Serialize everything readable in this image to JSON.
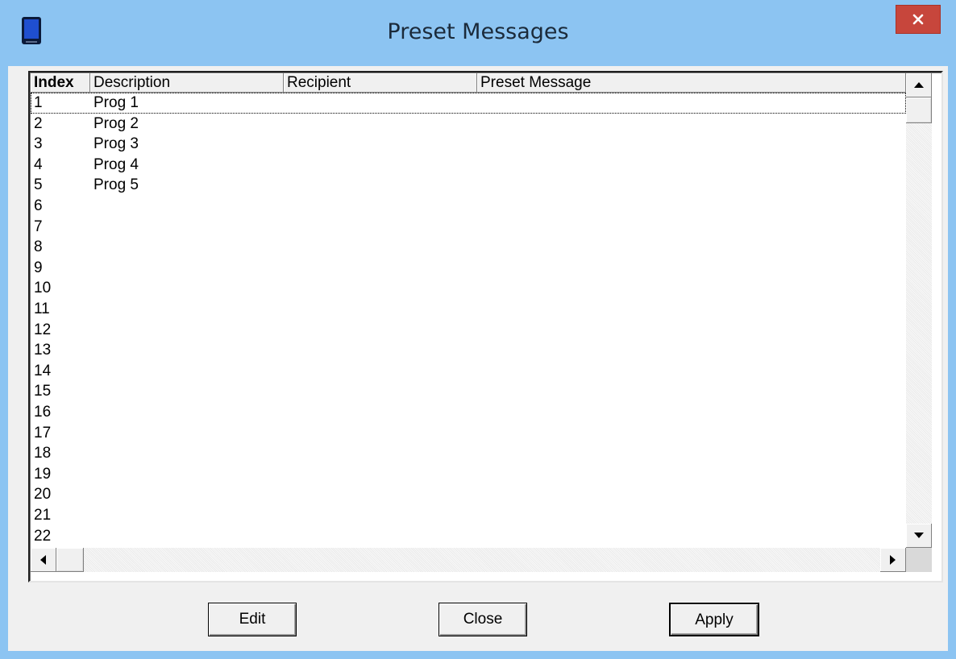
{
  "window": {
    "title": "Preset Messages",
    "icon": "phone-icon",
    "close_icon": "close-icon",
    "titlebar_color": "#8cc4f2",
    "close_color": "#c7463c"
  },
  "list": {
    "columns": [
      {
        "label": "Index"
      },
      {
        "label": "Description"
      },
      {
        "label": "Recipient"
      },
      {
        "label": "Preset Message"
      }
    ],
    "rows": [
      {
        "index": "1",
        "description": "Prog 1",
        "recipient": "",
        "message": ""
      },
      {
        "index": "2",
        "description": "Prog 2",
        "recipient": "",
        "message": ""
      },
      {
        "index": "3",
        "description": "Prog 3",
        "recipient": "",
        "message": ""
      },
      {
        "index": "4",
        "description": "Prog 4",
        "recipient": "",
        "message": ""
      },
      {
        "index": "5",
        "description": "Prog 5",
        "recipient": "",
        "message": ""
      },
      {
        "index": "6",
        "description": "",
        "recipient": "",
        "message": ""
      },
      {
        "index": "7",
        "description": "",
        "recipient": "",
        "message": ""
      },
      {
        "index": "8",
        "description": "",
        "recipient": "",
        "message": ""
      },
      {
        "index": "9",
        "description": "",
        "recipient": "",
        "message": ""
      },
      {
        "index": "10",
        "description": "",
        "recipient": "",
        "message": ""
      },
      {
        "index": "11",
        "description": "",
        "recipient": "",
        "message": ""
      },
      {
        "index": "12",
        "description": "",
        "recipient": "",
        "message": ""
      },
      {
        "index": "13",
        "description": "",
        "recipient": "",
        "message": ""
      },
      {
        "index": "14",
        "description": "",
        "recipient": "",
        "message": ""
      },
      {
        "index": "15",
        "description": "",
        "recipient": "",
        "message": ""
      },
      {
        "index": "16",
        "description": "",
        "recipient": "",
        "message": ""
      },
      {
        "index": "17",
        "description": "",
        "recipient": "",
        "message": ""
      },
      {
        "index": "18",
        "description": "",
        "recipient": "",
        "message": ""
      },
      {
        "index": "19",
        "description": "",
        "recipient": "",
        "message": ""
      },
      {
        "index": "20",
        "description": "",
        "recipient": "",
        "message": ""
      },
      {
        "index": "21",
        "description": "",
        "recipient": "",
        "message": ""
      },
      {
        "index": "22",
        "description": "",
        "recipient": "",
        "message": ""
      }
    ]
  },
  "buttons": {
    "edit": "Edit",
    "close": "Close",
    "apply": "Apply"
  }
}
